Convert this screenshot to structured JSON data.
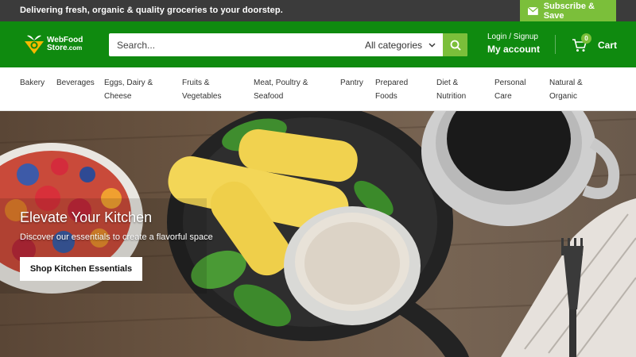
{
  "announcement": {
    "text": "Delivering fresh, organic & quality groceries to your doorstep.",
    "subscribe_label": "Subscribe & Save"
  },
  "header": {
    "logo_line1": "WebFood",
    "logo_line2": "Store",
    "logo_suffix": ".com",
    "search_placeholder": "Search...",
    "category_label": "All categories",
    "account_top": "Login / Signup",
    "account_main": "My account",
    "cart_count": "0",
    "cart_label": "Cart"
  },
  "nav": {
    "items": [
      {
        "line1": "Bakery",
        "line2": ""
      },
      {
        "line1": "Beverages",
        "line2": ""
      },
      {
        "line1": "Eggs, Dairy &",
        "line2": "Cheese"
      },
      {
        "line1": "Fruits &",
        "line2": "Vegetables"
      },
      {
        "line1": "Meat, Poultry &",
        "line2": "Seafood"
      },
      {
        "line1": "Pantry",
        "line2": ""
      },
      {
        "line1": "Prepared",
        "line2": "Foods"
      },
      {
        "line1": "Diet &",
        "line2": "Nutrition"
      },
      {
        "line1": "Personal",
        "line2": "Care"
      },
      {
        "line1": "Natural &",
        "line2": "Organic"
      }
    ]
  },
  "hero": {
    "title": "Elevate Your Kitchen",
    "subtitle": "Discover our essentials to create a flavorful space",
    "cta_label": "Shop Kitchen Essentials"
  },
  "colors": {
    "header_green": "#0f8a0f",
    "accent_green": "#7bbf3a",
    "topbar_dark": "#3b3b3b"
  },
  "icons": [
    "mail-icon",
    "search-icon",
    "chevron-down-icon",
    "cart-icon",
    "logo-icon"
  ]
}
